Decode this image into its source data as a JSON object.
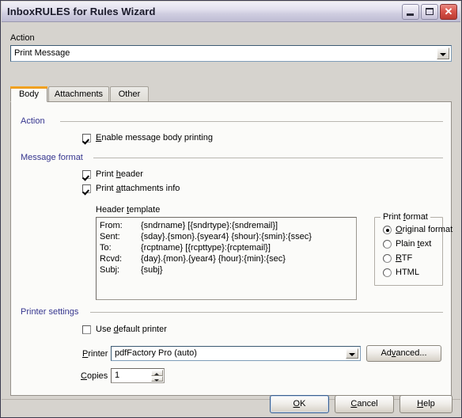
{
  "window": {
    "title": "InboxRULES for Rules Wizard",
    "caption_buttons": [
      {
        "name": "minimize",
        "glyph": "minimize-icon"
      },
      {
        "name": "maximize",
        "glyph": "maximize-icon"
      },
      {
        "name": "close",
        "glyph": "close-icon",
        "label": "✕"
      }
    ]
  },
  "action": {
    "label": "Action",
    "combo_value": "Print Message",
    "combo_arrow": "chevron-down-icon"
  },
  "tabs": [
    {
      "label": "Body",
      "active": true
    },
    {
      "label": "Attachments",
      "active": false
    },
    {
      "label": "Other",
      "active": false
    }
  ],
  "body_tab": {
    "action_group": {
      "label": "Action",
      "checkboxes": [
        {
          "label_pre": "",
          "accel": "E",
          "label_post": "nable message body printing",
          "checked": true
        }
      ]
    },
    "message_format_group": {
      "label": "Message format",
      "checkboxes": [
        {
          "label_pre": "Print ",
          "accel": "h",
          "label_post": "eader",
          "checked": true
        },
        {
          "label_pre": "Print ",
          "accel": "a",
          "label_post": "ttachments info",
          "checked": true
        }
      ],
      "header_template": {
        "label_pre": "Header ",
        "accel": "t",
        "label_post": "emplate",
        "lines": [
          {
            "key": "From:",
            "value": "{sndrname} [{sndrtype}:{sndremail}]"
          },
          {
            "key": "Sent:",
            "value": "{sday}.{smon}.{syear4} {shour}:{smin}:{ssec}"
          },
          {
            "key": "To:",
            "value": "{rcptname} [{rcpttype}:{rcptemail}]"
          },
          {
            "key": "Rcvd:",
            "value": "{day}.{mon}.{year4} {hour}:{min}:{sec}"
          },
          {
            "key": "Subj:",
            "value": "{subj}"
          }
        ]
      },
      "print_format": {
        "title_pre": "Print ",
        "accel": "f",
        "title_post": "ormat",
        "options": [
          {
            "label_pre": "",
            "accel": "O",
            "label_post": "riginal format",
            "selected": true
          },
          {
            "label_pre": "Plain ",
            "accel": "t",
            "label_post": "ext",
            "selected": false
          },
          {
            "label_pre": "",
            "accel": "R",
            "label_post": "TF",
            "selected": false
          },
          {
            "label_pre": "HTML",
            "accel": "",
            "label_post": "",
            "selected": false
          }
        ]
      }
    },
    "printer_settings_group": {
      "label": "Printer settings",
      "use_default_printer": {
        "label_pre": "Use ",
        "accel": "d",
        "label_post": "efault printer",
        "checked": false
      },
      "printer_label_pre": "",
      "printer_accel": "P",
      "printer_label_post": "rinter",
      "printer_value": "pdfFactory Pro (auto)",
      "advanced_button": {
        "label_pre": "Ad",
        "accel": "v",
        "label_post": "anced..."
      },
      "copies_label_pre": "",
      "copies_accel": "C",
      "copies_label_post": "opies",
      "copies_value": "1"
    }
  },
  "footer": {
    "buttons": [
      {
        "label_pre": "",
        "accel": "O",
        "label_post": "K",
        "default": true
      },
      {
        "label_pre": "",
        "accel": "C",
        "label_post": "ancel",
        "default": false
      },
      {
        "label_pre": "",
        "accel": "H",
        "label_post": "elp",
        "default": false
      }
    ]
  },
  "colors": {
    "titlebar_start": "#f2f1f8",
    "titlebar_end": "#bfbdd4",
    "close_button": "#c43f33",
    "group_label": "#36368f",
    "tab_accent": "#f2a127",
    "dialog_face": "#d6d3ce",
    "panel_face": "#fbfbf9"
  }
}
